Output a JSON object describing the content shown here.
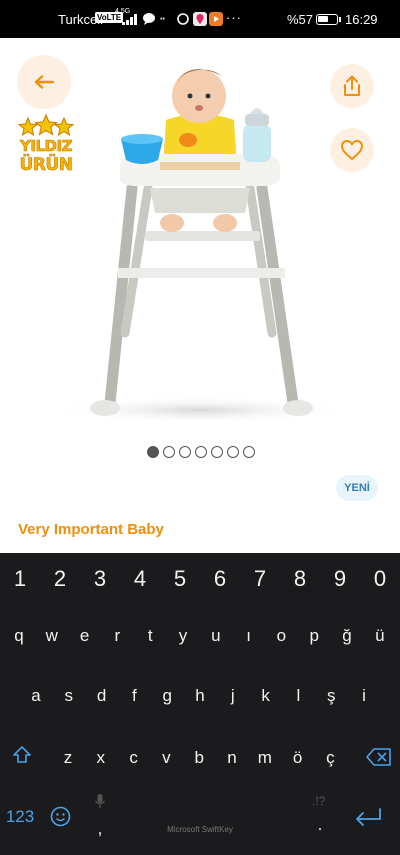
{
  "status_bar": {
    "carrier": "Turkcell",
    "volte": "VoLTE",
    "network": "4.5G",
    "battery": "%57",
    "battery_level": 0.57,
    "time": "16:29",
    "more": "···"
  },
  "product": {
    "badge_line1": "YILDIZ",
    "badge_line2": "ÜRÜN",
    "image_index": 1,
    "image_count": 7,
    "new_label": "YENİ",
    "brand": "Very Important Baby"
  },
  "keyboard": {
    "digits": [
      "1",
      "2",
      "3",
      "4",
      "5",
      "6",
      "7",
      "8",
      "9",
      "0"
    ],
    "row1": [
      "q",
      "w",
      "e",
      "r",
      "t",
      "y",
      "u",
      "ı",
      "o",
      "p",
      "ğ",
      "ü"
    ],
    "row2": [
      "a",
      "s",
      "d",
      "f",
      "g",
      "h",
      "j",
      "k",
      "l",
      "ş",
      "i"
    ],
    "row3": [
      "z",
      "x",
      "c",
      "v",
      "b",
      "n",
      "m",
      "ö",
      "ç"
    ],
    "numbers_label": "123",
    "comma": ",",
    "period": ".",
    "ghost_punct": ".!?",
    "brand": "Microsoft SwiftKey"
  },
  "colors": {
    "accent_orange": "#f0900a",
    "button_bg": "#fdf0e3",
    "keyboard_bg": "#1b1b1d",
    "keyboard_accent": "#4aa3e8"
  }
}
